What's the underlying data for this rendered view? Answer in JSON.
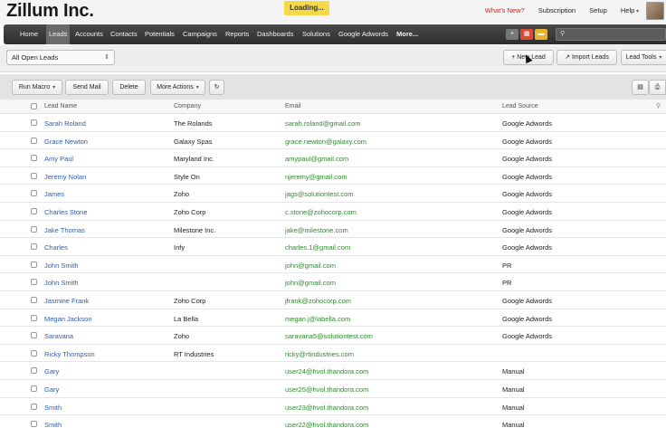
{
  "header": {
    "logo": "Zillum Inc.",
    "loading": "Loading...",
    "links": [
      "What's New?",
      "Subscription",
      "Setup",
      "Help"
    ]
  },
  "nav": {
    "tabs": [
      "Home",
      "Leads",
      "Accounts",
      "Contacts",
      "Potentials",
      "Campaigns",
      "Reports",
      "Dashboards",
      "Solutions",
      "Google Adwords",
      "More..."
    ],
    "active_tab": "Leads",
    "icons": [
      "plus-icon",
      "calendar-icon",
      "note-icon"
    ],
    "search_icon_glyph": "⚲"
  },
  "viewbar": {
    "view_select": "All Open Leads",
    "new_lead": "New Lead",
    "import_leads": "Import Leads",
    "lead_tools": "Lead Tools"
  },
  "actions": {
    "run_macro": "Run Macro",
    "send_mail": "Send Mail",
    "delete": "Delete",
    "more_actions": "More Actions"
  },
  "table": {
    "columns": [
      "Lead Name",
      "Company",
      "Email",
      "Lead Source"
    ],
    "rows": [
      {
        "name": "Sarah Roland",
        "company": "The Rolands",
        "email": "sarah.roland@gmail.com",
        "source": "Google Adwords"
      },
      {
        "name": "Grace Newton",
        "company": "Galaxy Spas",
        "email": "grace.newton@galaxy.com",
        "source": "Google Adwords"
      },
      {
        "name": "Amy Paul",
        "company": "Maryland Inc.",
        "email": "amypaul@gmail.com",
        "source": "Google Adwords"
      },
      {
        "name": "Jeremy Nolan",
        "company": "Style On",
        "email": "njeremy@gmail.com",
        "source": "Google Adwords"
      },
      {
        "name": "James",
        "company": "Zoho",
        "email": "jags@solutiontest.com",
        "source": "Google Adwords"
      },
      {
        "name": "Charles Stone",
        "company": "Zoho Corp",
        "email": "c.stone@zohocorp.com",
        "source": "Google Adwords"
      },
      {
        "name": "Jake Thomas",
        "company": "Milestone Inc.",
        "email": "jake@milestone.com",
        "source": "Google Adwords"
      },
      {
        "name": "Charles",
        "company": "Infy",
        "email": "charles.1@gmail.com",
        "source": "Google Adwords"
      },
      {
        "name": "John Smith",
        "company": "",
        "email": "john@gmail.com",
        "source": "PR"
      },
      {
        "name": "John Smith",
        "company": "",
        "email": "john@gmail.com",
        "source": "PR"
      },
      {
        "name": "Jasmine Frank",
        "company": "Zoho Corp",
        "email": "jfrank@zohocorp.com",
        "source": "Google Adwords"
      },
      {
        "name": "Megan Jackson",
        "company": "La Bella",
        "email": "megan.j@labella.com",
        "source": "Google Adwords"
      },
      {
        "name": "Saravana",
        "company": "Zoho",
        "email": "saravana5@solutiontest.com",
        "source": "Google Adwords"
      },
      {
        "name": "Ricky Thompson",
        "company": "RT Industries",
        "email": "ricky@rtindustries.com",
        "source": ""
      },
      {
        "name": "Gary",
        "company": "",
        "email": "user24@hvol.thandora.com",
        "source": "Manual"
      },
      {
        "name": "Gary",
        "company": "",
        "email": "user25@hvol.thandora.com",
        "source": "Manual"
      },
      {
        "name": "Smith",
        "company": "",
        "email": "user23@hvol.thandora.com",
        "source": "Manual"
      },
      {
        "name": "Smith",
        "company": "",
        "email": "user22@hvol.thandora.com",
        "source": "Manual"
      }
    ]
  }
}
